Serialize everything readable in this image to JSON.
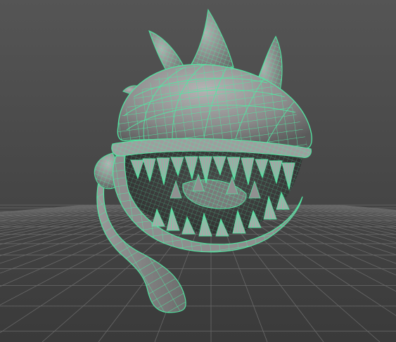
{
  "viewport": {
    "background_top": "#555555",
    "background_bottom": "#3a3a3a",
    "grid_color": "#6a6a6a",
    "wire_color": "#52e6a2",
    "mesh_color": "#8c8c8c"
  },
  "model": {
    "selected": true,
    "display_mode": "wireframe-on-shaded"
  }
}
